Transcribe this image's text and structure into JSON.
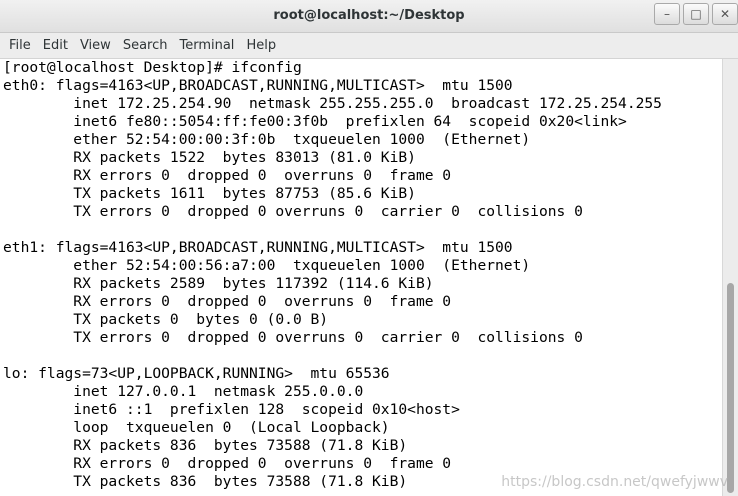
{
  "window": {
    "title": "root@localhost:~/Desktop",
    "controls": {
      "minimize_glyph": "–",
      "maximize_glyph": "□",
      "close_glyph": "✕"
    }
  },
  "menubar": {
    "items": [
      "File",
      "Edit",
      "View",
      "Search",
      "Terminal",
      "Help"
    ]
  },
  "terminal": {
    "lines": [
      "[root@localhost Desktop]# ifconfig",
      "eth0: flags=4163<UP,BROADCAST,RUNNING,MULTICAST>  mtu 1500",
      "        inet 172.25.254.90  netmask 255.255.255.0  broadcast 172.25.254.255",
      "        inet6 fe80::5054:ff:fe00:3f0b  prefixlen 64  scopeid 0x20<link>",
      "        ether 52:54:00:00:3f:0b  txqueuelen 1000  (Ethernet)",
      "        RX packets 1522  bytes 83013 (81.0 KiB)",
      "        RX errors 0  dropped 0  overruns 0  frame 0",
      "        TX packets 1611  bytes 87753 (85.6 KiB)",
      "        TX errors 0  dropped 0 overruns 0  carrier 0  collisions 0",
      "",
      "eth1: flags=4163<UP,BROADCAST,RUNNING,MULTICAST>  mtu 1500",
      "        ether 52:54:00:56:a7:00  txqueuelen 1000  (Ethernet)",
      "        RX packets 2589  bytes 117392 (114.6 KiB)",
      "        RX errors 0  dropped 0  overruns 0  frame 0",
      "        TX packets 0  bytes 0 (0.0 B)",
      "        TX errors 0  dropped 0 overruns 0  carrier 0  collisions 0",
      "",
      "lo: flags=73<UP,LOOPBACK,RUNNING>  mtu 65536",
      "        inet 127.0.0.1  netmask 255.0.0.0",
      "        inet6 ::1  prefixlen 128  scopeid 0x10<host>",
      "        loop  txqueuelen 0  (Local Loopback)",
      "        RX packets 836  bytes 73588 (71.8 KiB)",
      "        RX errors 0  dropped 0  overruns 0  frame 0",
      "        TX packets 836  bytes 73588 (71.8 KiB)"
    ]
  },
  "watermark": "https://blog.csdn.net/qwefyjwwv"
}
